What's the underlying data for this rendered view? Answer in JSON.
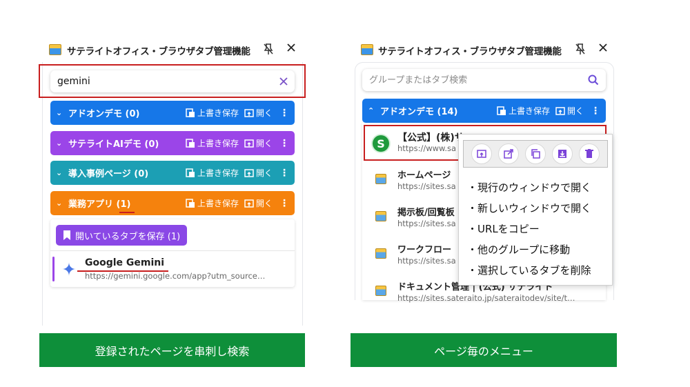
{
  "colors": {
    "blue": "#1677e8",
    "purple": "#9b45e8",
    "teal": "#1c9fb4",
    "orange": "#f5820d",
    "caption_green": "#0e8f3a",
    "highlight_red": "#c81e1e"
  },
  "left": {
    "title": "サテライトオフィス・ブラウザタブ管理機能",
    "search_value": "gemini",
    "groups": [
      {
        "name": "アドオンデモ (0)",
        "save": "上書き保存",
        "open": "開く",
        "color": "#1677e8"
      },
      {
        "name": "サテライトAIデモ (0)",
        "save": "上書き保存",
        "open": "開く",
        "color": "#9b45e8"
      },
      {
        "name": "導入事例ページ (0)",
        "save": "上書き保存",
        "open": "開く",
        "color": "#1c9fb4"
      },
      {
        "name": "業務アプリ (1)",
        "save": "上書き保存",
        "open": "開く",
        "color": "#f5820d"
      }
    ],
    "save_open_tabs": "開いているタブを保存 (1)",
    "tab": {
      "title": "Google Gemini",
      "url": "https://gemini.google.com/app?utm_source…"
    },
    "caption": "登録されたページを串刺し検索"
  },
  "right": {
    "title": "サテライトオフィス・ブラウザタブ管理機能",
    "search_placeholder": "グループまたはタブ検索",
    "group": {
      "name": "アドオンデモ (14)",
      "save": "上書き保存",
      "open": "開く",
      "color": "#1677e8"
    },
    "tabs": [
      {
        "title": "【公式】(株)サ",
        "url": "https://www.sa",
        "favicon": "s-logo-icon"
      },
      {
        "title": "ホームページ",
        "url": "https://sites.sa",
        "favicon": "site-icon"
      },
      {
        "title": "掲示板/回覧板",
        "url": "https://sites.sa",
        "favicon": "site-icon"
      },
      {
        "title": "ワークフロー",
        "url": "https://sites.sa",
        "favicon": "site-icon"
      },
      {
        "title": "ドキュメント管理 | (公式) サテライト",
        "url": "https://sites.sateraito.jp/sateraitodev/site/t…",
        "favicon": "site-icon"
      }
    ],
    "menu_items": [
      "・現行のウィンドウで開く",
      "・新しいウィンドウで開く",
      "・URLをコピー",
      "・他のグループに移動",
      "・選択しているタブを削除"
    ],
    "caption": "ページ毎のメニュー"
  }
}
